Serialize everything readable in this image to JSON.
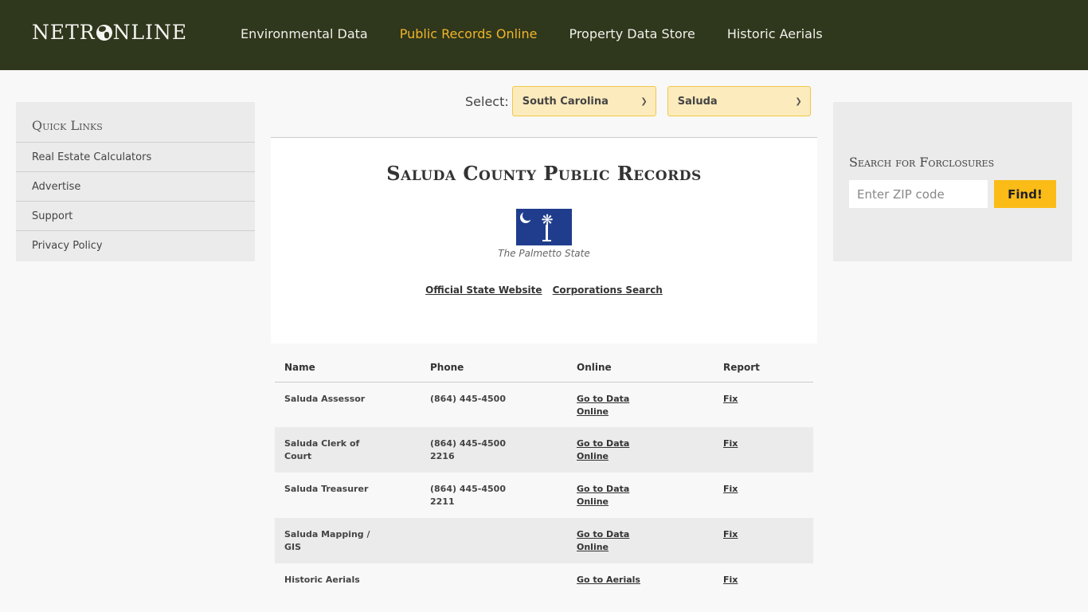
{
  "header": {
    "logo_text_left": "NETR",
    "logo_text_right": "NLINE",
    "nav": [
      {
        "label": "Environmental Data",
        "active": false
      },
      {
        "label": "Public Records Online",
        "active": true
      },
      {
        "label": "Property Data Store",
        "active": false
      },
      {
        "label": "Historic Aerials",
        "active": false
      }
    ],
    "accent_color": "#f0b429",
    "bg_color": "#2f371c"
  },
  "quick_links": {
    "title": "Quick Links",
    "items": [
      "Real Estate Calculators",
      "Advertise",
      "Support",
      "Privacy Policy"
    ]
  },
  "selector": {
    "label": "Select:",
    "state": "South Carolina",
    "county": "Saluda"
  },
  "main": {
    "title": "Saluda County Public Records",
    "flag_icon": "south-carolina-flag",
    "flag_caption": "The Palmetto State",
    "links": [
      "Official State Website",
      "Corporations Search"
    ]
  },
  "table": {
    "headers": [
      "Name",
      "Phone",
      "Online",
      "Report"
    ],
    "rows": [
      {
        "name": "Saluda Assessor",
        "phone": "(864) 445-4500",
        "online": "Go to Data Online",
        "report": "Fix"
      },
      {
        "name": "Saluda Clerk of Court",
        "phone": "(864) 445-4500 2216",
        "online": "Go to Data Online",
        "report": "Fix"
      },
      {
        "name": "Saluda Treasurer",
        "phone": "(864) 445-4500 2211",
        "online": "Go to Data Online",
        "report": "Fix"
      },
      {
        "name": "Saluda Mapping / GIS",
        "phone": "",
        "online": "Go to Data Online",
        "report": "Fix"
      },
      {
        "name": "Historic Aerials",
        "phone": "",
        "online": "Go to Aerials",
        "report": "Fix"
      }
    ]
  },
  "foreclosure": {
    "title": "Search for Forclosures",
    "placeholder": "Enter ZIP code",
    "button": "Find!",
    "button_color": "#fbbc18"
  }
}
